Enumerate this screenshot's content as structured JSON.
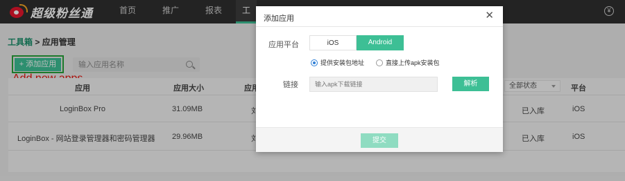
{
  "brand": {
    "name": "超级粉丝通"
  },
  "nav": {
    "items": [
      "首页",
      "推广",
      "报表",
      "工"
    ],
    "top_right_icon": "yen-icon"
  },
  "breadcrumb": {
    "root": "工具箱",
    "separator": " > ",
    "current": "应用管理"
  },
  "toolbar": {
    "add_label": "+ 添加应用",
    "search_placeholder": "输入应用名称",
    "annotation": "Add new apps"
  },
  "table": {
    "headers": {
      "app": "应用",
      "size": "应用大小",
      "version": "应用",
      "status_filter": "全部状态",
      "platform": "平台"
    },
    "rows": [
      {
        "name": "LoginBox Pro",
        "size": "31.09MB",
        "col3": "刘",
        "status": "已入库",
        "platform": "iOS"
      },
      {
        "name": "LoginBox - 网站登录管理器和密码管理器",
        "size": "29.96MB",
        "col3": "刘",
        "status": "已入库",
        "platform": "iOS"
      }
    ]
  },
  "modal": {
    "title": "添加应用",
    "platform_label": "应用平台",
    "platform_options": [
      "iOS",
      "Android"
    ],
    "platform_selected": "Android",
    "radio_options": [
      "提供安装包地址",
      "直接上传apk安装包"
    ],
    "radio_selected": "提供安装包地址",
    "link_label": "链接",
    "link_placeholder": "输入apk下载链接",
    "parse_label": "解析",
    "submit_label": "提交"
  },
  "colors": {
    "accent": "#3dbf95",
    "annotation": "#e4150e",
    "topbar": "#2f2f2f"
  }
}
